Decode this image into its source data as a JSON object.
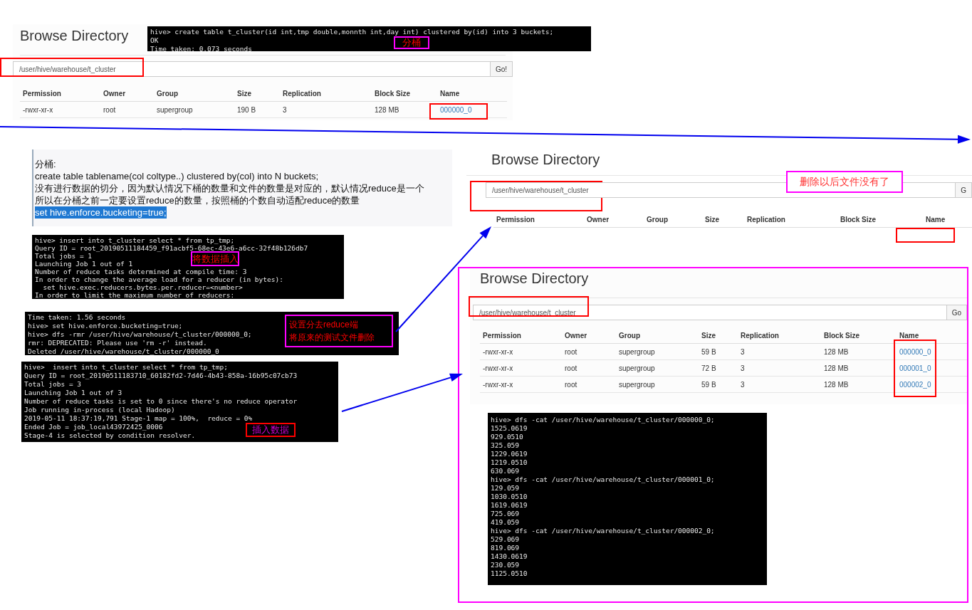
{
  "top_browser": {
    "title": "Browse Directory",
    "path": "/user/hive/warehouse/t_cluster",
    "go_button": "Go!",
    "columns": [
      "Permission",
      "Owner",
      "Group",
      "Size",
      "Replication",
      "Block Size",
      "Name"
    ],
    "rows": [
      [
        "-rwxr-xr-x",
        "root",
        "supergroup",
        "190 B",
        "3",
        "128 MB",
        "000000_0"
      ]
    ]
  },
  "create_terminal": {
    "lines": [
      "hive> create table t_cluster(id int,tmp double,monnth int,day int) clustered by(id) into 3 buckets;",
      "OK",
      "Time taken: 0.073 seconds"
    ]
  },
  "create_callout": "分桶",
  "note": {
    "lines": [
      {
        "text": "分桶:",
        "highlighted": false
      },
      {
        "text": "create table tablename(col coltype..) clustered by(col) into N buckets;",
        "highlighted": false
      },
      {
        "text": "没有进行数据的切分，因为默认情况下桶的数量和文件的数量是对应的，默认情况reduce是一个",
        "highlighted": false
      },
      {
        "text": "所以在分桶之前一定要设置reduce的数量，按照桶的个数自动适配reduce的数量",
        "highlighted": false
      },
      {
        "text": "set hive.enforce.bucketing=true;",
        "highlighted": true
      }
    ]
  },
  "insert_terminal": {
    "lines": [
      "hive> insert into t_cluster select * from tp_tmp;",
      "Query ID = root_20190511184459_f91acbf5-68ec-43e6-a6cc-32f48b126db7",
      "Total jobs = 1",
      "Launching Job 1 out of 1",
      "Number of reduce tasks determined at compile time: 3",
      "In order to change the average load for a reducer (in bytes):",
      "  set hive.exec.reducers.bytes.per.reducer=<number>",
      "In order to limit the maximum number of reducers:"
    ]
  },
  "insert_callout": "将数据插入",
  "bucketing_terminal": {
    "lines": [
      "Time taken: 1.56 seconds",
      "hive> set hive.enforce.bucketing=true;",
      "hive> dfs -rmr /user/hive/warehouse/t_cluster/000000_0;",
      "rmr: DEPRECATED: Please use 'rm -r' instead.",
      "Deleted /user/hive/warehouse/t_cluster/000000_0"
    ]
  },
  "bucketing_callouts": [
    "设置分去reduce端",
    "将原来的测试文件删除"
  ],
  "insert_terminal_2": {
    "lines": [
      "hive>  insert into t_cluster select * from tp_tmp;",
      "Query ID = root_20190511183710_60182fd2-7d46-4b43-858a-16b95c07cb73",
      "Total jobs = 3",
      "Launching Job 1 out of 3",
      "Number of reduce tasks is set to 0 since there's no reduce operator",
      "Job running in-process (local Hadoop)",
      "2019-05-11 18:37:19,791 Stage-1 map = 100%,  reduce = 0%",
      "Ended Job = job_local43972425_0006",
      "Stage-4 is selected by condition resolver."
    ]
  },
  "insert_callout_2": "插入数据",
  "deleted_browser": {
    "title": "Browse Directory",
    "path": "/user/hive/warehouse/t_cluster",
    "go_button": "G",
    "columns": [
      "Permission",
      "Owner",
      "Group",
      "Size",
      "Replication",
      "Block Size",
      "Name"
    ]
  },
  "deleted_callout": "删除以后文件没有了",
  "result_browser": {
    "title": "Browse Directory",
    "path": "/user/hive/warehouse/t_cluster",
    "go_button": "Go",
    "columns": [
      "Permission",
      "Owner",
      "Group",
      "Size",
      "Replication",
      "Block Size",
      "Name"
    ],
    "rows": [
      [
        "-rwxr-xr-x",
        "root",
        "supergroup",
        "59 B",
        "3",
        "128 MB",
        "000000_0"
      ],
      [
        "-rwxr-xr-x",
        "root",
        "supergroup",
        "72 B",
        "3",
        "128 MB",
        "000001_0"
      ],
      [
        "-rwxr-xr-x",
        "root",
        "supergroup",
        "59 B",
        "3",
        "128 MB",
        "000002_0"
      ]
    ]
  },
  "cat_terminal": {
    "lines": [
      "hive> dfs -cat /user/hive/warehouse/t_cluster/000000_0;",
      "1525.0619",
      "929.0510",
      "325.059",
      "1229.0619",
      "1219.0510",
      "630.069",
      "hive> dfs -cat /user/hive/warehouse/t_cluster/000001_0;",
      "129.059",
      "1030.0510",
      "1619.0619",
      "725.069",
      "419.059",
      "hive> dfs -cat /user/hive/warehouse/t_cluster/000002_0;",
      "529.069",
      "819.069",
      "1430.0619",
      "230.059",
      "1125.0510"
    ]
  }
}
